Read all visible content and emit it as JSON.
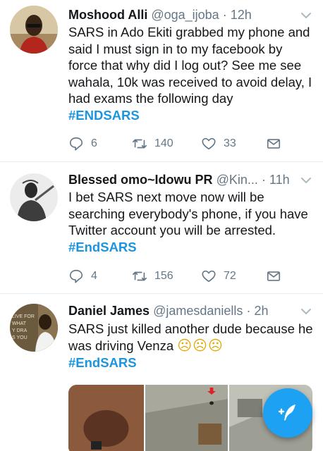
{
  "tweets": [
    {
      "name": "Moshood Alli",
      "handle": "@oga_ijoba",
      "time": "12h",
      "text": "SARS in Ado Ekiti grabbed my phone and said I must sign in to my facebook by force that why did I log out?  See me see wahala, 10k was received to avoid delay, I had exams the following day",
      "hashtag": "#ENDSARS",
      "replies": "6",
      "retweets": "140",
      "likes": "33"
    },
    {
      "name": "Blessed omo~Idowu PR",
      "handle": "@Kin...",
      "time": "11h",
      "text": "I bet SARS next move now will be searching everybody's phone, if you have Twitter account you will be arrested.",
      "hashtag": "#EndSARS",
      "replies": "4",
      "retweets": "156",
      "likes": "72"
    },
    {
      "name": "Daniel James",
      "handle": "@jamesdaniells",
      "time": "2h",
      "text": "SARS just killed another dude because he was driving Venza",
      "emoji": "☹☹☹",
      "hashtag": "#EndSARS",
      "avatar_caption": "LIVE FOR\nWHAT\nY DRA\nS YOU"
    }
  ],
  "icons": {
    "reply": "reply-icon",
    "retweet": "retweet-icon",
    "like": "heart-icon",
    "share": "envelope-icon",
    "menu": "chevron-down-icon",
    "compose": "compose-tweet-icon"
  },
  "colors": {
    "accent": "#1da1f2",
    "hashtag": "#1b95e0",
    "secondary_text": "#657786",
    "divider": "#e6ecf0"
  }
}
